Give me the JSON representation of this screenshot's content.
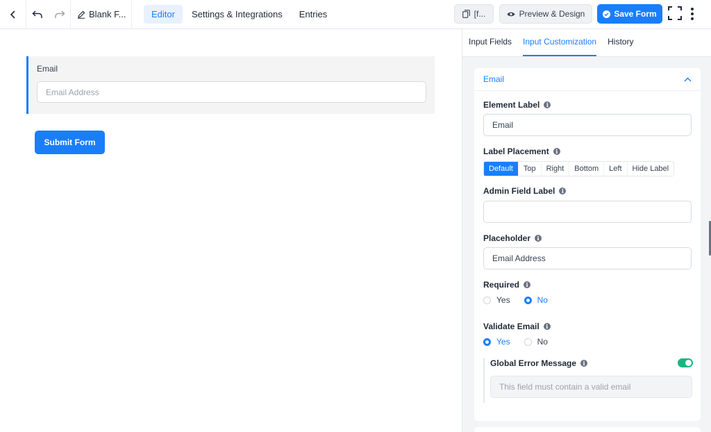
{
  "topbar": {
    "form_title": "Blank F...",
    "nav": [
      "Editor",
      "Settings & Integrations",
      "Entries"
    ],
    "shortcode_label": "[f...",
    "preview_label": "Preview & Design",
    "save_label": "Save Form",
    "icons": [
      "chevron-left-icon",
      "undo-icon",
      "redo-icon",
      "pencil-icon",
      "copy-icon",
      "eye-icon",
      "check-circle-icon",
      "fullscreen-icon",
      "more-vertical-icon"
    ]
  },
  "canvas": {
    "field_label": "Email",
    "field_placeholder": "Email Address",
    "submit_label": "Submit Form"
  },
  "panel": {
    "tabs": [
      "Input Fields",
      "Input Customization",
      "History"
    ],
    "active_tab": "Input Customization",
    "card_title": "Email",
    "element_label": {
      "label": "Element Label",
      "value": "Email"
    },
    "label_placement": {
      "label": "Label Placement",
      "options": [
        "Default",
        "Top",
        "Right",
        "Bottom",
        "Left",
        "Hide Label"
      ],
      "selected": "Default"
    },
    "admin_field_label": {
      "label": "Admin Field Label",
      "value": ""
    },
    "placeholder": {
      "label": "Placeholder",
      "value": "Email Address"
    },
    "required": {
      "label": "Required",
      "options": [
        "Yes",
        "No"
      ],
      "selected": "No"
    },
    "validate_email": {
      "label": "Validate Email",
      "options": [
        "Yes",
        "No"
      ],
      "selected": "Yes"
    },
    "global_error": {
      "label": "Global Error Message",
      "enabled": true,
      "placeholder": "This field must contain a valid email"
    }
  },
  "colors": {
    "accent": "#1a7efb",
    "toggle_on": "#10b981"
  }
}
